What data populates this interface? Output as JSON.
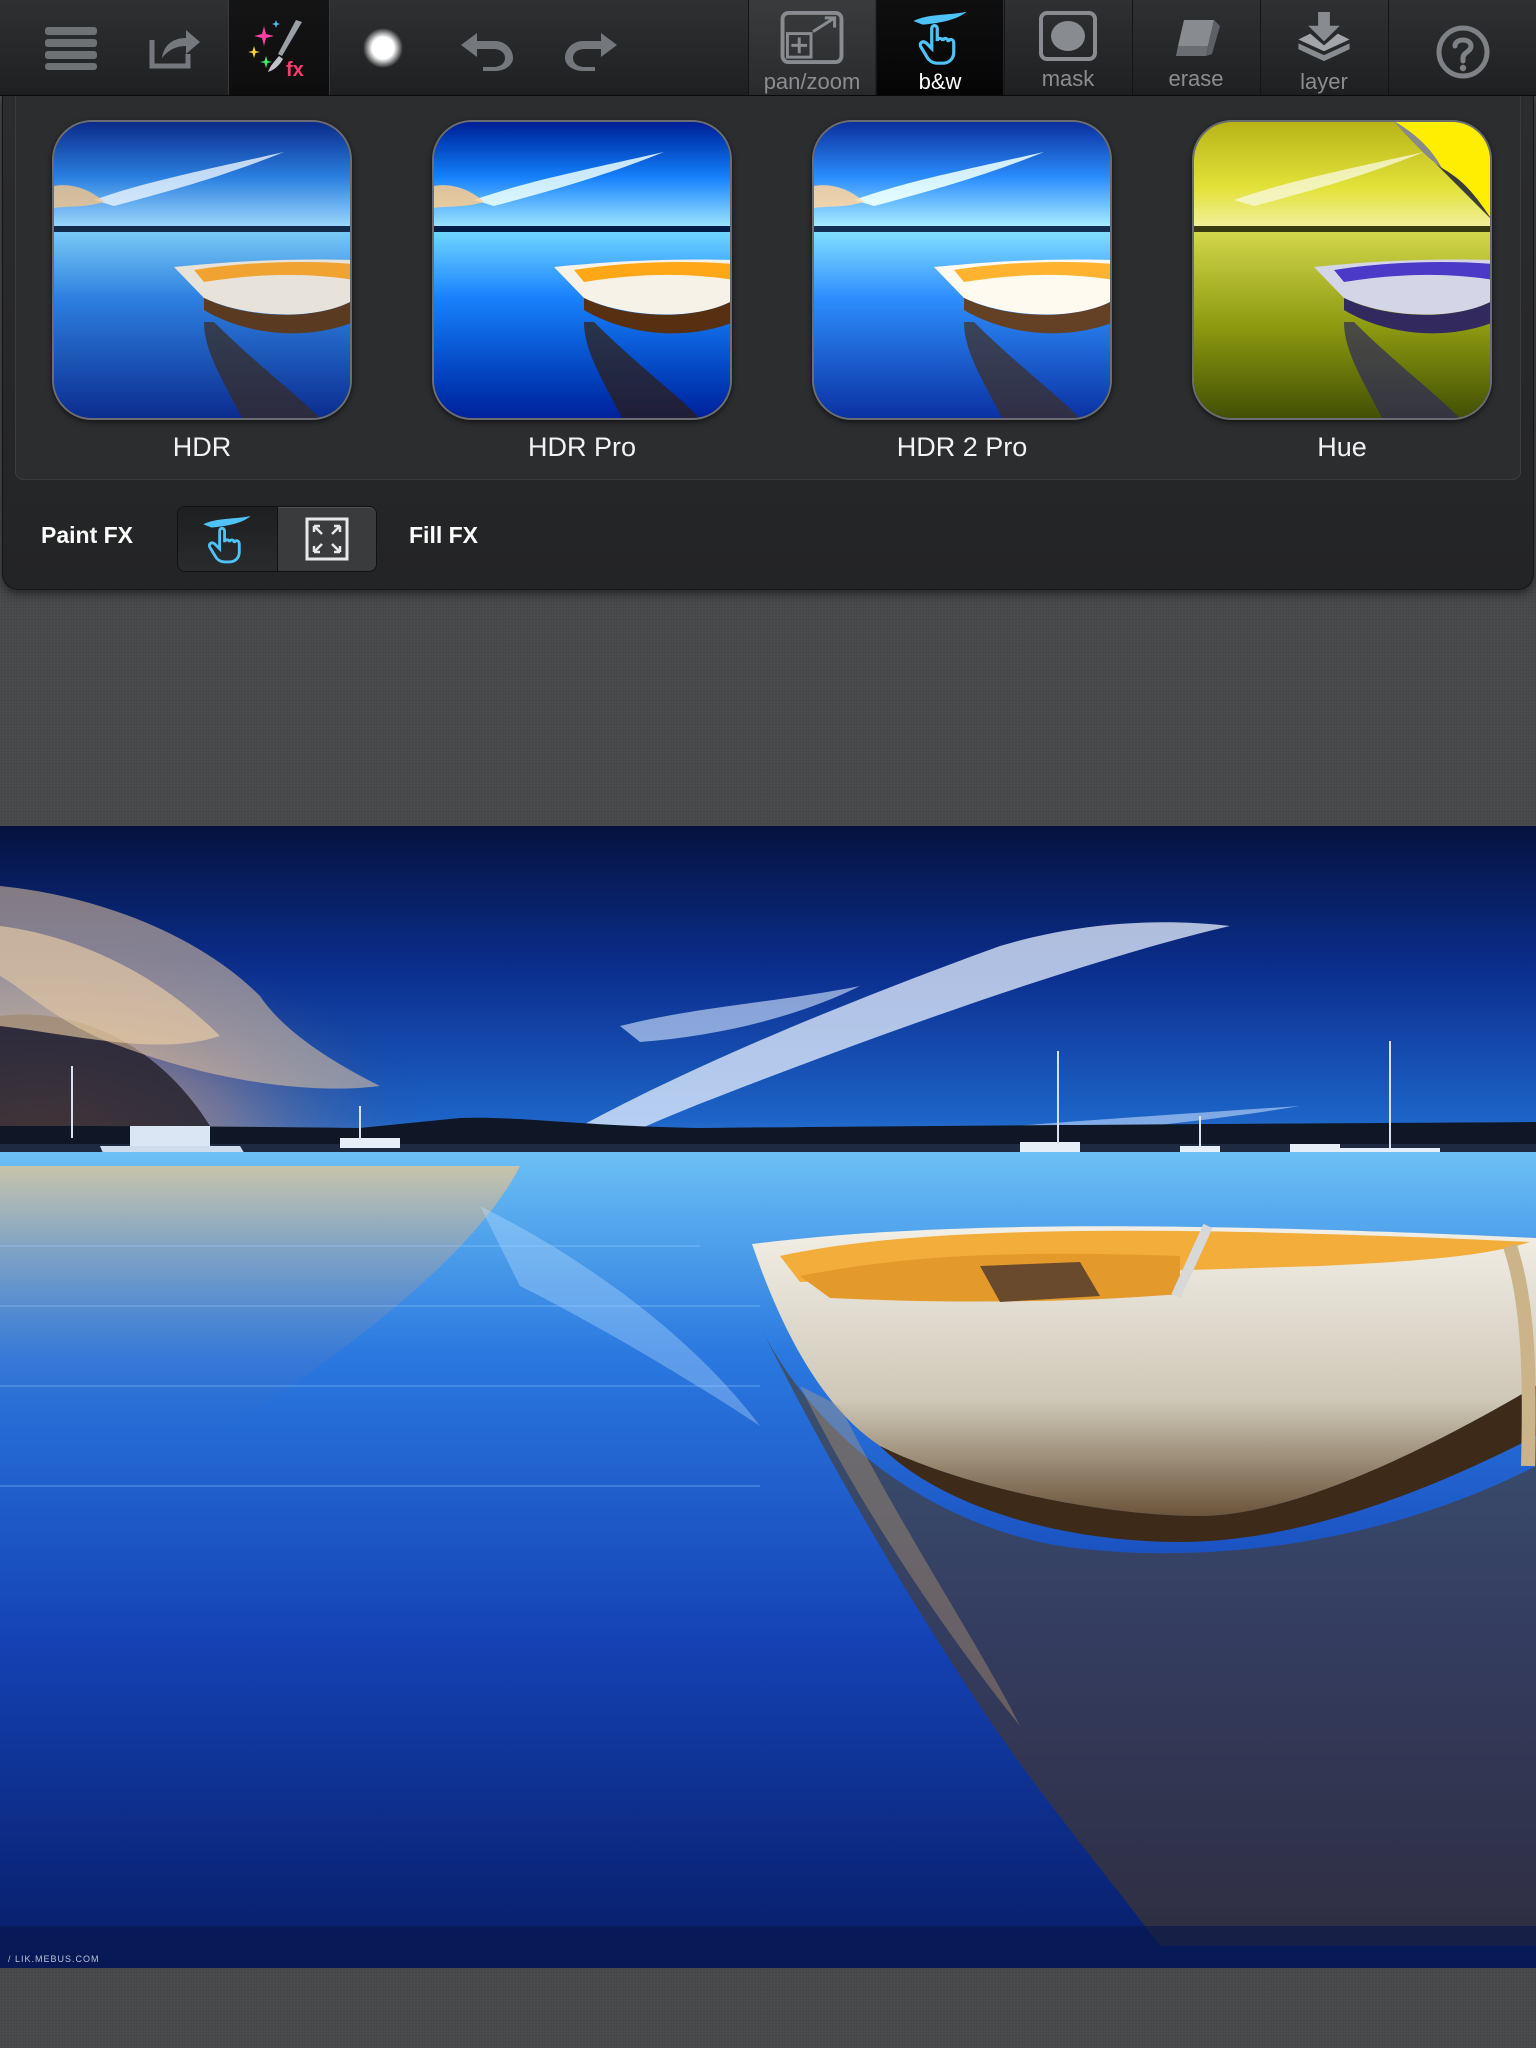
{
  "toolbar": {
    "tools": [
      {
        "name": "menu-icon"
      },
      {
        "name": "share-icon"
      },
      {
        "name": "fx-brush-icon",
        "fx_text": "fx",
        "active": true
      },
      {
        "name": "brush-size-icon"
      },
      {
        "name": "undo-icon"
      },
      {
        "name": "redo-icon"
      }
    ],
    "modes": [
      {
        "label": "pan/zoom",
        "icon": "pan-zoom-icon"
      },
      {
        "label": "b&w",
        "icon": "paint-hand-icon",
        "active": true
      },
      {
        "label": "mask",
        "icon": "mask-icon"
      },
      {
        "label": "erase",
        "icon": "eraser-icon"
      },
      {
        "label": "layer",
        "icon": "layer-icon"
      }
    ],
    "help_icon": "help-icon"
  },
  "fx_panel": {
    "effects": [
      {
        "label": "HDR",
        "style": "hdr"
      },
      {
        "label": "HDR Pro",
        "style": "hdr-pro"
      },
      {
        "label": "HDR 2 Pro",
        "style": "hdr2"
      },
      {
        "label": "Hue",
        "style": "hue",
        "locked_icon": "page-curl-icon"
      }
    ],
    "paint_fx_label": "Paint FX",
    "fill_fx_label": "Fill FX",
    "mode_selected": "paint"
  },
  "photo": {
    "watermark": "/ LIK.MEBUS.COM"
  },
  "colors": {
    "toolbar_bg": "#262729",
    "active_accent": "#4fc3f7",
    "text_dim": "#8b8d90",
    "sky_blue": "#1c4fb8",
    "boat_orange": "#e9a235"
  }
}
